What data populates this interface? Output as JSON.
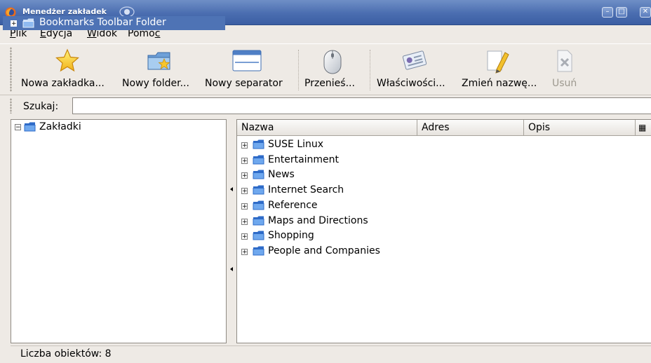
{
  "window": {
    "title": "Menedżer zakładek",
    "buttons": [
      "minimize",
      "maximize",
      "close"
    ]
  },
  "menu": {
    "items": [
      {
        "label": "Plik",
        "mnemonic": "P"
      },
      {
        "label": "Edycja",
        "mnemonic": "E"
      },
      {
        "label": "Widok",
        "mnemonic": "W"
      },
      {
        "label": "Pomoc",
        "mnemonic": "c"
      }
    ]
  },
  "toolbar": {
    "new_bookmark": "Nowa zakładka...",
    "new_folder": "Nowy folder...",
    "new_separator": "Nowy separator",
    "move": "Przenieś...",
    "properties": "Właściwości...",
    "rename": "Zmień nazwę...",
    "delete": "Usuń"
  },
  "search": {
    "label": "Szukaj:",
    "value": ""
  },
  "tree": {
    "root": "Zakładki",
    "selected": "Bookmarks Toolbar Folder"
  },
  "list": {
    "columns": [
      "Nazwa",
      "Adres",
      "Opis"
    ],
    "rows": [
      "SUSE Linux",
      "Entertainment",
      "News",
      "Internet Search",
      "Reference",
      "Maps and Directions",
      "Shopping",
      "People and Companies"
    ]
  },
  "status": {
    "text": "Liczba obiektów: 8"
  },
  "colors": {
    "titlebar": "#4a6db0",
    "selection": "#4e73b5",
    "folder": "#3a78d6"
  },
  "icons": {
    "new_bookmark": "star-icon",
    "new_folder": "new-folder-icon",
    "new_separator": "window-separator-icon",
    "move": "mouse-icon",
    "properties": "properties-card-icon",
    "rename": "pencil-icon",
    "delete": "delete-x-icon"
  }
}
